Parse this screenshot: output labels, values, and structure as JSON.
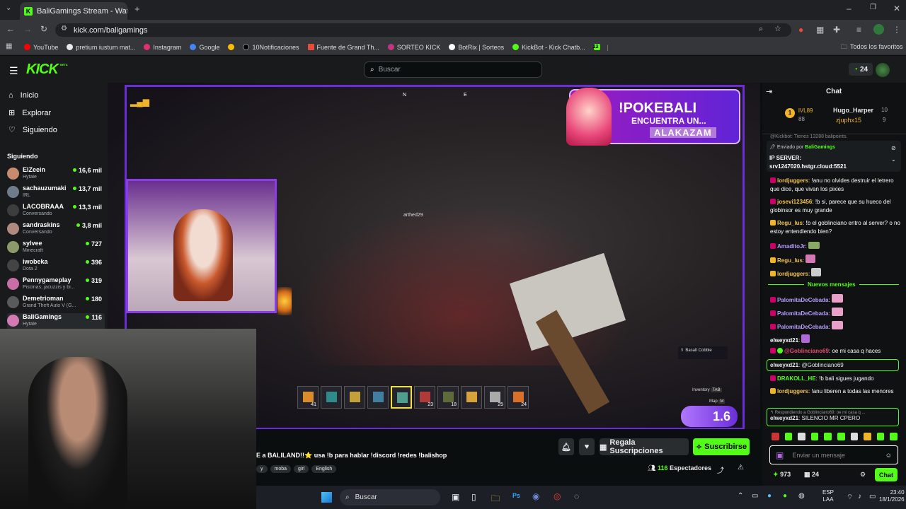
{
  "browser": {
    "tab_title": "BaliGamings Stream - Wat",
    "url": "kick.com/baligamings",
    "bookmarks": [
      {
        "label": "YouTube",
        "color": "#ff0000"
      },
      {
        "label": "pretium iustum mat...",
        "color": "#e8eaed"
      },
      {
        "label": "Instagram",
        "color": "#e1306c"
      },
      {
        "label": "Google",
        "color": "#4285f4"
      },
      {
        "label": "",
        "color": "#fbbc04"
      },
      {
        "label": "10Notificaciones",
        "color": "#000000"
      },
      {
        "label": "Fuente de Grand Th...",
        "color": "#e84b3c"
      },
      {
        "label": "SORTEO KICK",
        "color": "#c13584"
      },
      {
        "label": "BotRix | Sorteos",
        "color": "#ffffff"
      },
      {
        "label": "KickBot - Kick Chatb...",
        "color": "#53fc18"
      },
      {
        "label": "12",
        "color": "#53fc18"
      }
    ],
    "all_favorites": "Todos los favoritos"
  },
  "kick": {
    "logo": "KICK",
    "beta": "BETA",
    "search_placeholder": "Buscar",
    "points": "24",
    "nav": [
      {
        "label": "Inicio",
        "icon": "home-icon"
      },
      {
        "label": "Explorar",
        "icon": "compass-icon"
      },
      {
        "label": "Siguiendo",
        "icon": "heart-icon"
      }
    ],
    "following_title": "Siguiendo",
    "following": [
      {
        "name": "ElZeein",
        "game": "Hytale",
        "count": "16,6 mil",
        "color": "#c98b6e"
      },
      {
        "name": "sachauzumaki",
        "game": "IRL",
        "count": "13,7 mil",
        "color": "#6f7c8c"
      },
      {
        "name": "LACOBRAAA",
        "game": "Conversando",
        "count": "13,3 mil",
        "color": "#3d3d3d"
      },
      {
        "name": "sandraskins",
        "game": "Conversando",
        "count": "3,8 mil",
        "color": "#b08a7e"
      },
      {
        "name": "sylvee",
        "game": "Minecraft",
        "count": "727",
        "color": "#8c9a6b"
      },
      {
        "name": "iwobeka",
        "game": "Dota 2",
        "count": "396",
        "color": "#444"
      },
      {
        "name": "Pennygameplay",
        "game": "Piscinas, jacuzzis y bi...",
        "count": "319",
        "color": "#c96fa8"
      },
      {
        "name": "Demetrioman",
        "game": "Grand Theft Auto V (G...",
        "count": "180",
        "color": "#5a5a5a"
      },
      {
        "name": "BaliGamings",
        "game": "Hytale",
        "count": "116",
        "color": "#d47ab3"
      }
    ]
  },
  "stream": {
    "title_text": "E a BALILAND!!⭐ usa !b para hablar !discord !redes !balishop",
    "tags": [
      "y",
      "moba",
      "girl",
      "English"
    ],
    "viewers_count": "116",
    "viewers_label": "Espectadores",
    "gift_button": "Regala Suscripciones",
    "subscribe_button": "Suscribirse",
    "overlay": {
      "banner_line1": "!POKEBALI",
      "banner_line2": "ENCUENTRA UN...",
      "banner_line3": "ALAKAZAM",
      "player_name": "arthed29",
      "block_name": "Basalt Cobble",
      "block_count": "9",
      "inventory_label": "Inventory",
      "inventory_key": "TAB",
      "map_label": "Map",
      "map_key": "M",
      "version": "1.6",
      "compass_n": "N",
      "compass_e": "E",
      "hotbar": [
        {
          "count": "41",
          "color": "#d88c2a"
        },
        {
          "count": "",
          "color": "#2f8a8a"
        },
        {
          "count": "",
          "color": "#c2a03a"
        },
        {
          "count": "",
          "color": "#3f7f9f"
        },
        {
          "count": "",
          "color": "#4f9f8f"
        },
        {
          "count": "23",
          "color": "#b03a3a"
        },
        {
          "count": "18",
          "color": "#5f6a3a"
        },
        {
          "count": "",
          "color": "#d8a23a"
        },
        {
          "count": "25",
          "color": "#aaaaaa"
        },
        {
          "count": "24",
          "color": "#d8702a"
        }
      ]
    }
  },
  "chat": {
    "title": "Chat",
    "leaderboard": {
      "level": "lVL89",
      "level_points": "88",
      "top_user": "Hugo_Harper",
      "top_points": "10",
      "second_user": "zjuphx15",
      "second_points": "9"
    },
    "clipped_message": "@Kickbot: Tienes 13288 balipoints.",
    "pinned": {
      "sent_by_label": "Enviado por",
      "sender": "BaliGamings",
      "line1": "IP SERVER:",
      "line2": "srv1247020.hstgr.cloud:5521"
    },
    "messages": [
      {
        "user": "lordjuggers",
        "text": "!anu no olvides destruir el letrero que dice, que vivan los pixies",
        "color": "#f2c14e"
      },
      {
        "user": "josevi123456",
        "text": "!b si, parece que su hueco del globinsor es muy grande",
        "color": "#f2c14e"
      },
      {
        "user": "Regu_lus",
        "text": "!b el goblinciano entro al server? o no estoy entendiendo bien?",
        "color": "#f2c14e"
      },
      {
        "user": "AmaditoJr",
        "text": "",
        "color": "#b69cff"
      },
      {
        "user": "Regu_lus",
        "text": "",
        "color": "#f2c14e"
      },
      {
        "user": "lordjuggers",
        "text": "",
        "color": "#f2c14e"
      }
    ],
    "new_messages_label": "Nuevos mensajes",
    "new_messages": [
      {
        "user": "PalomitaDeCebada",
        "text": "",
        "color": "#b69cff"
      },
      {
        "user": "PalomitaDeCebada",
        "text": "",
        "color": "#b69cff"
      },
      {
        "user": "PalomitaDeCebada",
        "text": "",
        "color": "#b69cff"
      },
      {
        "user": "elweyxd21",
        "text": "",
        "color": "#ffffff"
      },
      {
        "user": "@Goblinciano69",
        "text": "oe mi casa q haces",
        "color": "#e84b6c"
      },
      {
        "user": "elweyxd21",
        "text": "@Goblinciano69",
        "color": "#ffffff"
      },
      {
        "user": "DRAKOLL_HE",
        "text": "!b bali sigues jugando",
        "color": "#53fc18"
      },
      {
        "user": "lordjuggers",
        "text": "!anu liberen a todas las menores",
        "color": "#f2c14e"
      }
    ],
    "reply": {
      "context": "Respondiendo a Goblinciano69: oe mi casa q ...",
      "user": "elweyxd21",
      "text": "SILENCIO MR CPERO"
    },
    "input_placeholder": "Enviar un mensaje",
    "points_count": "973",
    "gift_count": "24",
    "send_button": "Chat"
  },
  "taskbar": {
    "search": "Buscar",
    "lang1": "ESP",
    "lang2": "LAA",
    "time": "23:40",
    "date": "18/1/2026"
  }
}
